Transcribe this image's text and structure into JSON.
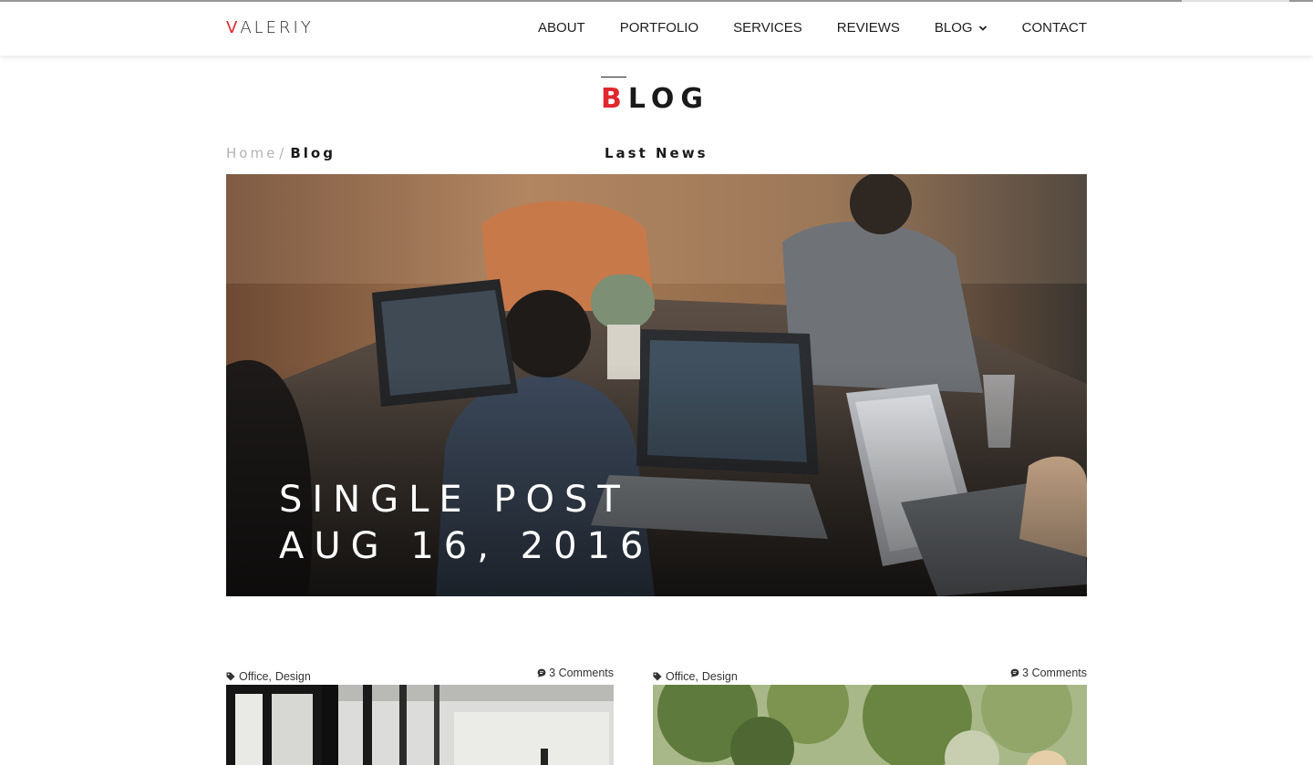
{
  "brand": {
    "first_letter": "V",
    "rest": "ALERIY",
    "accent": "#e0272d"
  },
  "nav": {
    "items": [
      "ABOUT",
      "PORTFOLIO",
      "SERVICES",
      "REVIEWS",
      "BLOG",
      "CONTACT"
    ],
    "dropdown_icon": "chevron-down-icon"
  },
  "page": {
    "title_first": "B",
    "title_rest": "LOG",
    "subtitle": "Last News"
  },
  "breadcrumb": {
    "home": "Home",
    "separator": "/",
    "current": "Blog"
  },
  "hero": {
    "line1": "SINGLE POST",
    "line2": "AUG 16, 2016",
    "image": "team working on laptops around wooden table"
  },
  "posts": [
    {
      "tag1": "Office",
      "tag2": "Design",
      "comments": "3 Comments",
      "tag_icon": "tag-icon",
      "comment_icon": "comment-icon",
      "image": "office interior with windows"
    },
    {
      "tag1": "Office",
      "tag2": "Design",
      "comments": "3 Comments",
      "tag_icon": "tag-icon",
      "comment_icon": "comment-icon",
      "image": "person outdoors under trees"
    }
  ]
}
